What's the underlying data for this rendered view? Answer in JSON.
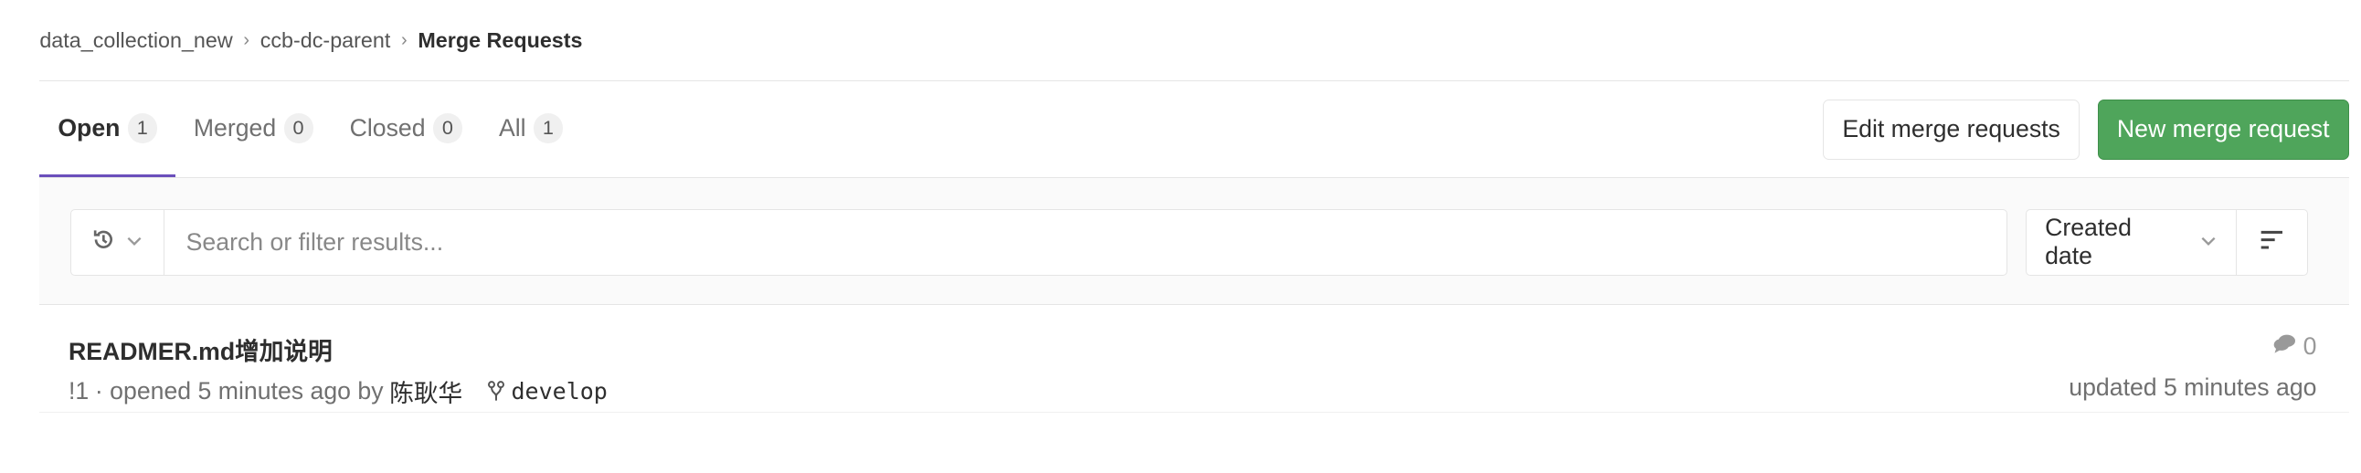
{
  "breadcrumb": {
    "items": [
      "data_collection_new",
      "ccb-dc-parent",
      "Merge Requests"
    ]
  },
  "tabs": [
    {
      "label": "Open",
      "count": "1"
    },
    {
      "label": "Merged",
      "count": "0"
    },
    {
      "label": "Closed",
      "count": "0"
    },
    {
      "label": "All",
      "count": "1"
    }
  ],
  "actions": {
    "edit_label": "Edit merge requests",
    "new_label": "New merge request"
  },
  "filter": {
    "placeholder": "Search or filter results...",
    "sort_label": "Created date"
  },
  "merge_request": {
    "title": "READMER.md增加说明",
    "ref": "!1",
    "opened": "· opened 5 minutes ago by",
    "author": "陈耿华",
    "branch": "develop",
    "comments": "0",
    "updated": "updated 5 minutes ago"
  },
  "colors": {
    "accent_tab": "#6b4fbb",
    "primary_button": "#4fa55b"
  }
}
